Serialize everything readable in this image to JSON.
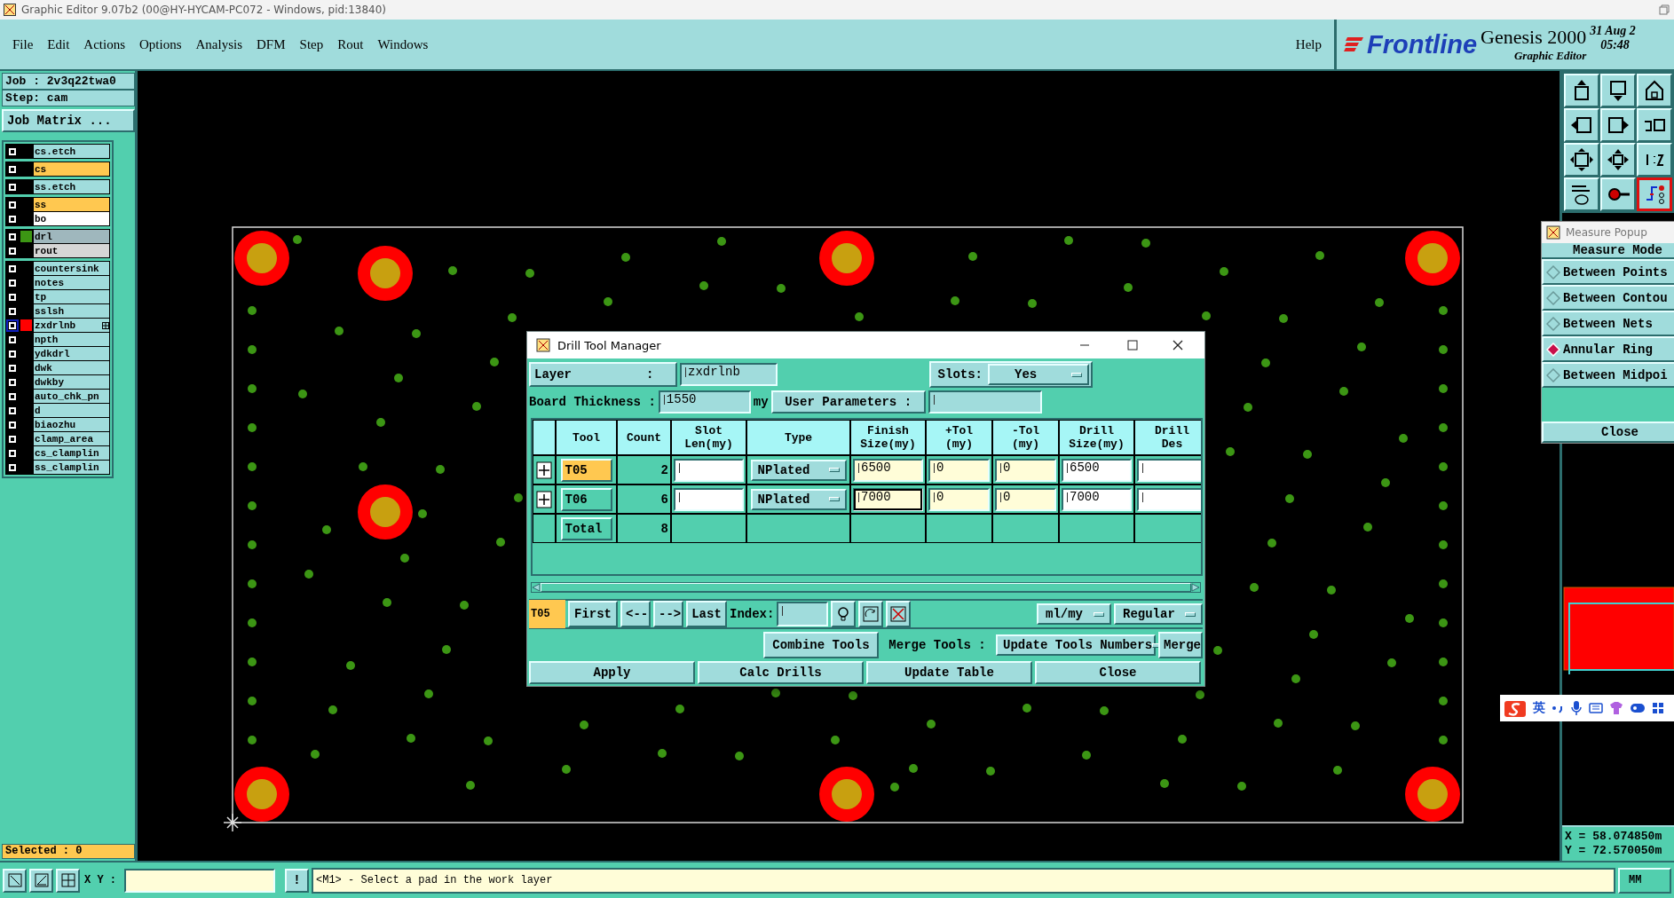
{
  "window": {
    "title": "Graphic Editor 9.07b2 (00@HY-HYCAM-PC072 - Windows, pid:13840)"
  },
  "menu": [
    {
      "label": "File"
    },
    {
      "label": "Edit"
    },
    {
      "label": "Actions"
    },
    {
      "label": "Options"
    },
    {
      "label": "Analysis"
    },
    {
      "label": "DFM"
    },
    {
      "label": "Step"
    },
    {
      "label": "Rout"
    },
    {
      "label": "Windows"
    }
  ],
  "help": "Help",
  "brand": {
    "logo": "Frontline",
    "product": "Genesis 2000",
    "subtitle": "Graphic Editor",
    "date": "31 Aug 2",
    "time": "05:48"
  },
  "job_panel": {
    "job": "Job : 2v3q22twa0",
    "step": "Step: cam",
    "matrix_button": "Job Matrix ...",
    "layer_groups": [
      {
        "layers": [
          {
            "name": "cs.etch",
            "kind": "misc",
            "selected": false
          }
        ]
      },
      {
        "layers": [
          {
            "name": "cs",
            "kind": "signal",
            "selected": false
          }
        ]
      },
      {
        "layers": [
          {
            "name": "ss.etch",
            "kind": "misc",
            "selected": false
          }
        ]
      },
      {
        "layers": [
          {
            "name": "ss",
            "kind": "signal",
            "selected": false
          },
          {
            "name": "bo",
            "kind": "board",
            "selected": false
          }
        ]
      },
      {
        "layers": [
          {
            "name": "drl",
            "kind": "drill",
            "color": "#3c9614",
            "selected": false
          },
          {
            "name": "rout",
            "kind": "rout",
            "selected": false
          }
        ]
      },
      {
        "layers": [
          {
            "name": "countersink",
            "kind": "misc",
            "selected": false
          },
          {
            "name": "notes",
            "kind": "misc",
            "selected": false
          },
          {
            "name": "tp",
            "kind": "misc",
            "selected": false
          },
          {
            "name": "sslsh",
            "kind": "misc",
            "selected": false
          },
          {
            "name": "zxdrlnb",
            "kind": "misc",
            "color": "#ff0000",
            "selected": true
          },
          {
            "name": "npth",
            "kind": "misc",
            "selected": false
          },
          {
            "name": "ydkdrl",
            "kind": "misc",
            "selected": false
          },
          {
            "name": "dwk",
            "kind": "misc",
            "selected": false
          },
          {
            "name": "dwkby",
            "kind": "misc",
            "selected": false
          },
          {
            "name": "auto_chk_pn",
            "kind": "misc",
            "selected": false
          },
          {
            "name": "d",
            "kind": "misc",
            "selected": false
          },
          {
            "name": "biaozhu",
            "kind": "misc",
            "selected": false
          },
          {
            "name": "clamp_area",
            "kind": "misc",
            "selected": false
          },
          {
            "name": "cs_clamplin",
            "kind": "misc",
            "selected": false
          },
          {
            "name": "ss_clamplin",
            "kind": "misc",
            "selected": false
          }
        ]
      }
    ],
    "selected_count": "Selected : 0"
  },
  "drill_dialog": {
    "title": "Drill Tool Manager",
    "layer_label": "Layer          :",
    "layer_value": "zxdrlnb",
    "slots_label": "Slots:",
    "slots_value": "Yes",
    "thickness_label": "Board Thickness :",
    "thickness_value": "1550",
    "thickness_unit": "my",
    "user_params_label": "User Parameters :",
    "columns": [
      "Tool",
      "Count",
      "Slot\nLen(my)",
      "Type",
      "Finish\nSize(my)",
      "+Tol\n(my)",
      "-Tol\n(my)",
      "Drill\nSize(my)",
      "Drill\nDes"
    ],
    "rows": [
      {
        "tool": "T05",
        "selected": true,
        "count": "2",
        "type": "NPlated",
        "finish": "6500",
        "finish_focused": false,
        "plus_tol": "0",
        "minus_tol": "0",
        "drill": "6500"
      },
      {
        "tool": "T06",
        "selected": false,
        "count": "6",
        "type": "NPlated",
        "finish": "7000",
        "finish_focused": true,
        "plus_tol": "0",
        "minus_tol": "0",
        "drill": "7000"
      }
    ],
    "total": {
      "label": "Total",
      "count": "8"
    },
    "nav": {
      "current": "T05",
      "first": "First",
      "prev": "<--",
      "next": "-->",
      "last": "Last",
      "index_label": "Index:",
      "units": "ml/my",
      "mode": "Regular"
    },
    "merge": {
      "combine": "Combine Tools",
      "merge_label": "Merge Tools :",
      "merge_option": "Update Tools Numbers",
      "merge": "Merge"
    },
    "buttons": [
      "Apply",
      "Calc Drills",
      "Update Table",
      "Close"
    ]
  },
  "tool_grid": [
    {
      "kind": "export",
      "selected": false
    },
    {
      "kind": "import",
      "selected": false
    },
    {
      "kind": "home",
      "selected": false
    },
    {
      "kind": "left",
      "selected": false
    },
    {
      "kind": "right",
      "selected": false
    },
    {
      "kind": "undo",
      "selected": false
    },
    {
      "kind": "fit",
      "selected": false
    },
    {
      "kind": "center",
      "selected": false
    },
    {
      "kind": "scale",
      "selected": false
    },
    {
      "kind": "tools",
      "selected": false
    },
    {
      "kind": "pad",
      "selected": false
    },
    {
      "kind": "net",
      "selected": true
    }
  ],
  "measure_popup": {
    "title": "Measure Popup",
    "header": "Measure Mode",
    "modes": [
      {
        "label": "Between Points",
        "selected": false
      },
      {
        "label": "Between Contou",
        "selected": false
      },
      {
        "label": "Between Nets",
        "selected": false
      },
      {
        "label": "Annular Ring",
        "selected": true
      },
      {
        "label": "Between Midpoi",
        "selected": false
      }
    ],
    "close": "Close"
  },
  "ime_bar": {
    "label": "英"
  },
  "coordinates": {
    "x": "X = 58.074850m",
    "y": "Y = 72.570050m"
  },
  "status_bar": {
    "xy_label": "X Y :",
    "alert": "!",
    "message": "<M1> - Select a pad in the work layer",
    "units": "MM"
  }
}
